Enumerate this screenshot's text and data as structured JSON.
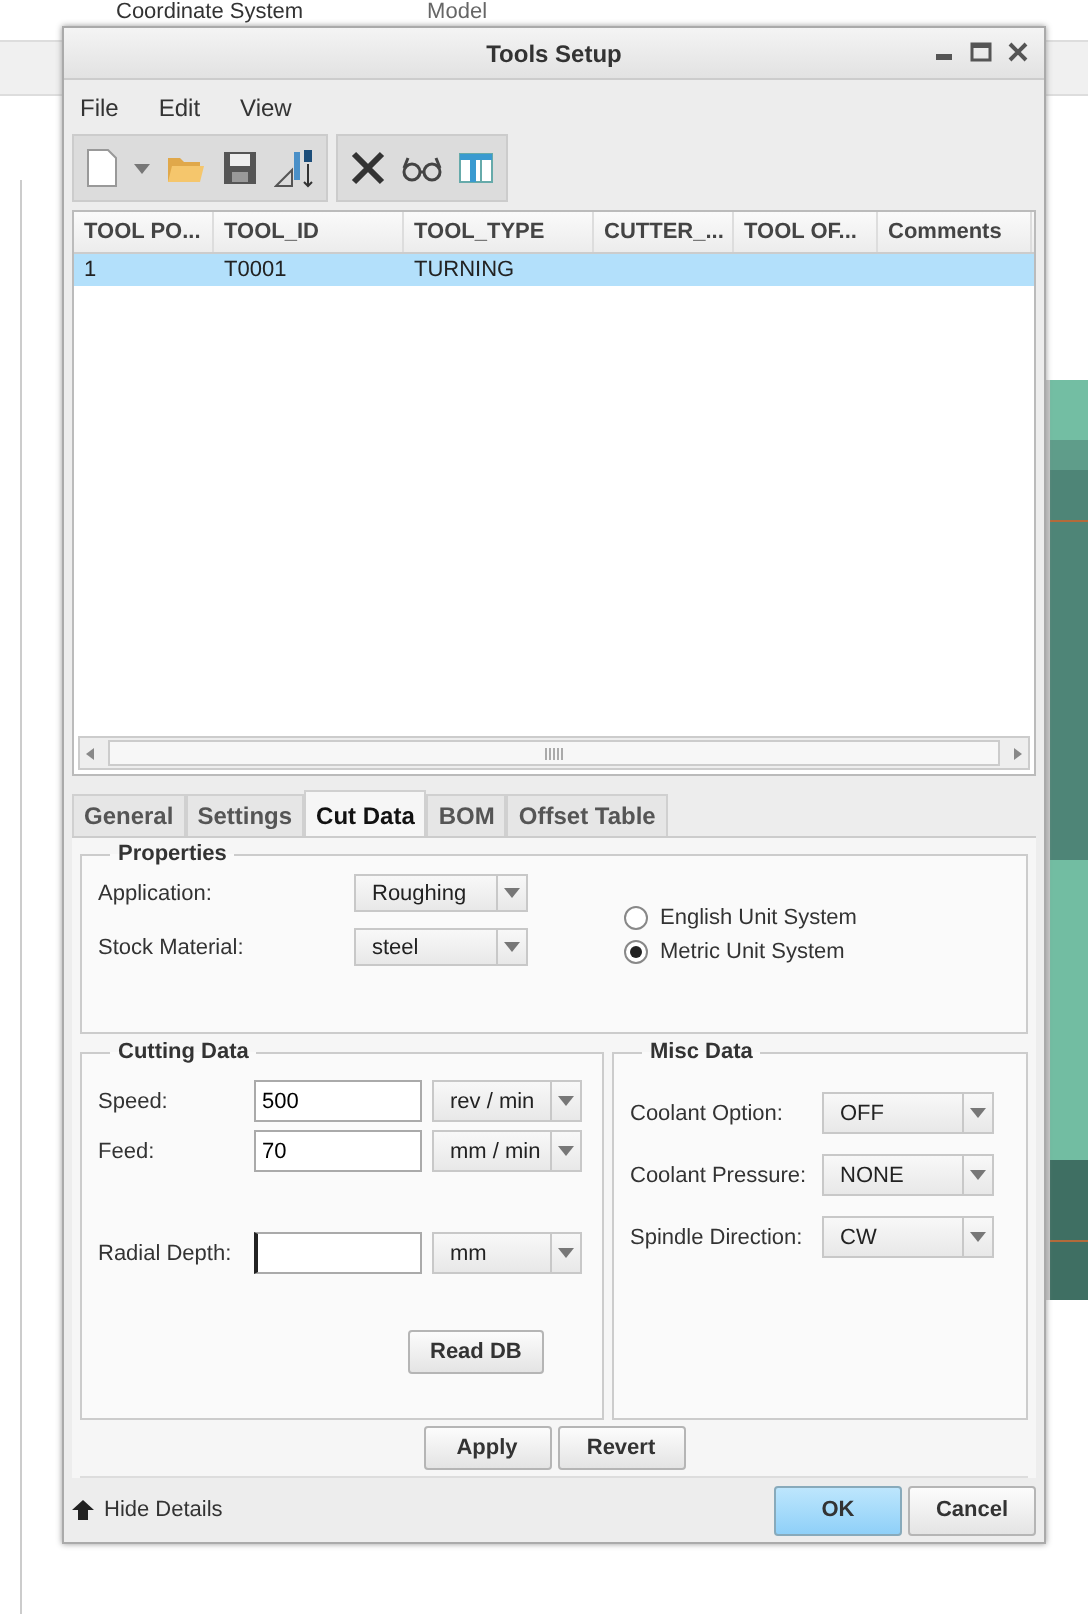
{
  "background_app": {
    "ribbon_labels": [
      "Coordinate System",
      "Model"
    ]
  },
  "window": {
    "title": "Tools Setup"
  },
  "menu": [
    "File",
    "Edit",
    "View"
  ],
  "table": {
    "columns": [
      "TOOL PO...",
      "TOOL_ID",
      "TOOL_TYPE",
      "CUTTER_...",
      "TOOL OF...",
      "Comments"
    ],
    "rows": [
      {
        "cells": [
          "1",
          "T0001",
          "TURNING",
          "",
          "",
          ""
        ],
        "selected": true
      }
    ]
  },
  "tabs": [
    {
      "label": "General",
      "selected": false
    },
    {
      "label": "Settings",
      "selected": false
    },
    {
      "label": "Cut Data",
      "selected": true
    },
    {
      "label": "BOM",
      "selected": false
    },
    {
      "label": "Offset Table",
      "selected": false
    }
  ],
  "properties": {
    "title": "Properties",
    "fields": [
      {
        "label": "Application:",
        "value": "Roughing"
      },
      {
        "label": "Stock Material:",
        "value": "steel"
      }
    ],
    "units": [
      {
        "label": "English Unit System",
        "selected": false
      },
      {
        "label": "Metric Unit System",
        "selected": true
      }
    ]
  },
  "cutting_data": {
    "title": "Cutting Data",
    "fields": [
      {
        "label": "Speed:",
        "value": "500",
        "unit": "rev / min"
      },
      {
        "label": "Feed:",
        "value": "70",
        "unit": "mm / min"
      },
      {
        "label": "Radial Depth:",
        "unit": "mm",
        "focused": true
      }
    ],
    "button": "Read DB"
  },
  "misc_data": {
    "title": "Misc Data",
    "fields": [
      {
        "label": "Coolant Option:",
        "value": "OFF"
      },
      {
        "label": "Coolant Pressure:",
        "value": "NONE"
      },
      {
        "label": "Spindle Direction:",
        "value": "CW"
      }
    ]
  },
  "apply_buttons": [
    "Apply",
    "Revert"
  ],
  "footer": {
    "toggle": "Hide Details",
    "buttons": [
      {
        "label": "OK",
        "kind": "default"
      },
      {
        "label": "Cancel",
        "kind": "normal"
      }
    ]
  }
}
